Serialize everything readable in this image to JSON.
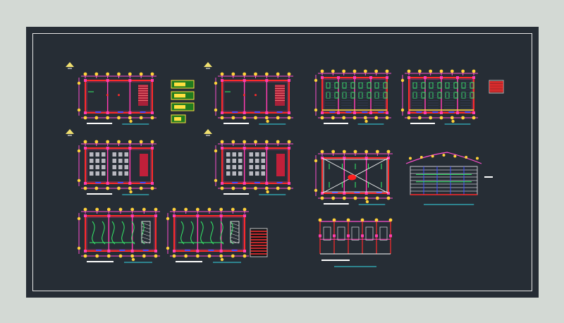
{
  "drawing": {
    "colors": {
      "background": "#d3d9d4",
      "canvas": "#262d35",
      "frame": "#e6e6e6",
      "wall": "#ff2a2a",
      "column": "#ff3db0",
      "node": "#ffd23a",
      "dimension": "#ff4fd0",
      "accent_blue": "#3a4dff",
      "accent_green": "#35f06a",
      "accent_cyan": "#35d9e6",
      "accent_white": "#ffffff",
      "legend": "#1f7a1f"
    },
    "sheets": [
      {
        "id": "plan-1",
        "kind": "plan-empty"
      },
      {
        "id": "plan-2",
        "kind": "plan-empty"
      },
      {
        "id": "plan-3",
        "kind": "plan-furniture"
      },
      {
        "id": "plan-4",
        "kind": "plan-furniture"
      },
      {
        "id": "plan-5",
        "kind": "plan-lighting"
      },
      {
        "id": "plan-6",
        "kind": "plan-lighting"
      },
      {
        "id": "plan-7",
        "kind": "plan-grid"
      },
      {
        "id": "plan-8",
        "kind": "plan-grid"
      },
      {
        "id": "plan-9",
        "kind": "plan-roof"
      },
      {
        "id": "section-1",
        "kind": "roof-section"
      },
      {
        "id": "elevation-1",
        "kind": "elevation"
      }
    ]
  }
}
